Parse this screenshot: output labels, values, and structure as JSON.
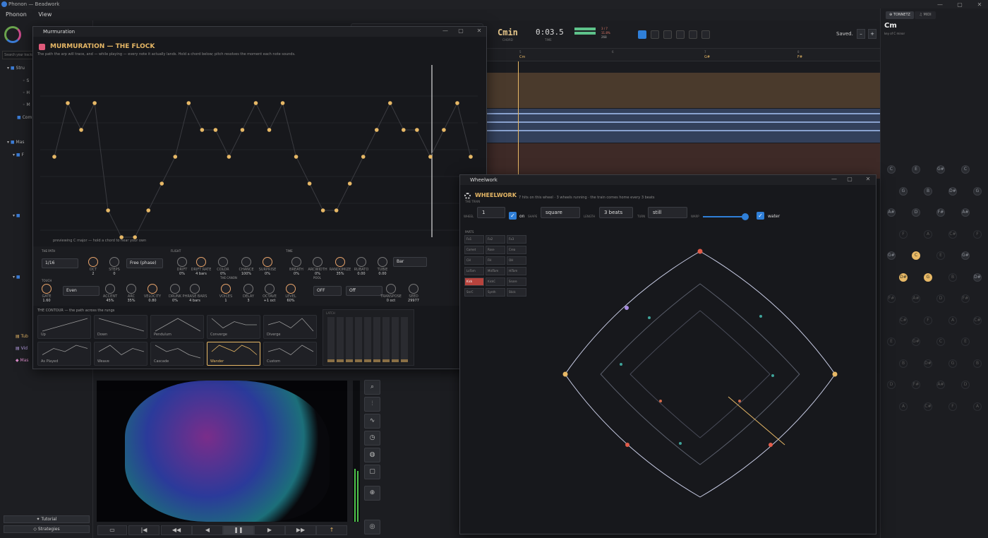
{
  "app": {
    "title": "Phonon — Beadwork",
    "menu": [
      "Phonon",
      "View"
    ]
  },
  "left": {
    "search_placeholder": "Search your tracks",
    "items": [
      "Stru",
      "S",
      "H",
      "M",
      "Com",
      "Mas",
      "F",
      "Tub",
      "Vid",
      "Mas"
    ],
    "tutorial": "✦ Tutorial",
    "strategies": "◇ Strategies"
  },
  "topbar": {
    "chord": "Cmin",
    "chord_sub": "CHORD",
    "time": "0:03.5",
    "time_sub": "TIME",
    "meter": [
      "3 / 7",
      "11.8%",
      "268"
    ],
    "saved": "Saved.",
    "minus": "–",
    "plus": "+"
  },
  "timeline": {
    "markers": [
      "5",
      "6",
      "7",
      "8"
    ],
    "chords": [
      "Cm",
      "G#",
      "F#"
    ]
  },
  "tonnetz": {
    "tab1": "⊕ TONNETZ",
    "tab2": "♫ MIDI",
    "chord": "Cm",
    "key": "key of C minor"
  },
  "murmuration": {
    "window_title": "Murmuration",
    "title": "MURMURATION — THE FLOCK",
    "subtitle": "The path the arp will trace, and — while playing — every note it actually lands. Hold a chord below; pitch resolves the moment each note sounds.",
    "preview": "previewing C major — hold a chord to hear your own",
    "sec_path": "THE PATH",
    "sec_flight": "FLIGHT",
    "sec_time": "TIME",
    "sec_canon": "THE CANON",
    "sec_touch": "TOUCH",
    "sec_pool": "POOL",
    "path_rate": "1/16",
    "path_spread": "Free (phase)",
    "time_curve": "Bar",
    "touch_swing": "Even",
    "pool_latch": "OFF",
    "pool_mode": "Off",
    "knobs1": [
      {
        "l": "OCT",
        "v": "2"
      },
      {
        "l": "STEPS",
        "v": "0"
      },
      {
        "l": "DRIFT",
        "v": "0%"
      },
      {
        "l": "DRIFT RATE",
        "v": "4 bars"
      },
      {
        "l": "COLOR",
        "v": "0%"
      },
      {
        "l": "CHANCE",
        "v": "100%"
      },
      {
        "l": "SURPRISE",
        "v": "0%"
      },
      {
        "l": "BREATH",
        "v": "0%"
      },
      {
        "l": "ARCWIDTH",
        "v": "0%"
      },
      {
        "l": "RANDOMIZE",
        "v": "35%"
      },
      {
        "l": "RUBATO",
        "v": "0.00"
      },
      {
        "l": "TUBIE",
        "v": "0.00"
      }
    ],
    "knobs2": [
      {
        "l": "GATE",
        "v": "1.60"
      },
      {
        "l": "ACCENT",
        "v": "45%"
      },
      {
        "l": "ARC",
        "v": "35%"
      },
      {
        "l": "VELOCITY",
        "v": "0.80"
      },
      {
        "l": "DRUNK",
        "v": "0%"
      },
      {
        "l": "PHRASE BARS",
        "v": "4 bars"
      },
      {
        "l": "VOICES",
        "v": "1"
      },
      {
        "l": "DELAY",
        "v": "3"
      },
      {
        "l": "OCTAVE",
        "v": "+1 oct"
      },
      {
        "l": "LEVEL",
        "v": "60%"
      },
      {
        "l": "TRANSPOSE",
        "v": "0 oct"
      },
      {
        "l": "SEED",
        "v": "29977"
      }
    ],
    "contour_label": "THE CONTOUR — the path across the rungs",
    "shapes": [
      "Up",
      "Down",
      "Pendulum",
      "Converge",
      "Diverge",
      "As Played",
      "Weave",
      "Cascade",
      "Wander",
      "Custom"
    ],
    "selected_shape": "Wander",
    "path_points": [
      2,
      0,
      1,
      0,
      4,
      5,
      5,
      4,
      3,
      2,
      0,
      1,
      1,
      2,
      1,
      0,
      1,
      0,
      2,
      3,
      4,
      4,
      3,
      2,
      1,
      0,
      1,
      1,
      2,
      1,
      0,
      2
    ],
    "right_note": "LATCH"
  },
  "wheelwork": {
    "window_title": "Wheelwork",
    "title": "WHEELWORK",
    "sub": "THE TRAIN",
    "summary": "7 hits on this wheel · 3 wheels running · the train comes home every 3 beats",
    "wheel_label": "WHEEL",
    "wheel": "1",
    "on": "on",
    "shape_label": "SHAPE",
    "shape": "square",
    "length_label": "LENGTH",
    "length": "3 beats",
    "turn_label": "TURN",
    "turn": "still",
    "warp_label": "WARP",
    "water": "water",
    "parts_label": "PARTS",
    "parts": [
      [
        "Fx1",
        "Fx2",
        "Fx3"
      ],
      [
        "Comet",
        "Rose",
        "Crea"
      ],
      [
        "CH",
        "FH",
        "OH"
      ],
      [
        "LoTom",
        "MidTom",
        "HiTom"
      ],
      [
        "Kick",
        "KickC",
        "Snare"
      ],
      [
        "SnrC",
        "Synth",
        "Stick"
      ]
    ],
    "part_counts": [
      "1",
      "5",
      "2",
      "4"
    ]
  },
  "bottom": {
    "transport": [
      "▭",
      "|◀",
      "◀◀",
      "◀",
      "❚❚",
      "▶",
      "▶▶",
      "↑"
    ]
  }
}
